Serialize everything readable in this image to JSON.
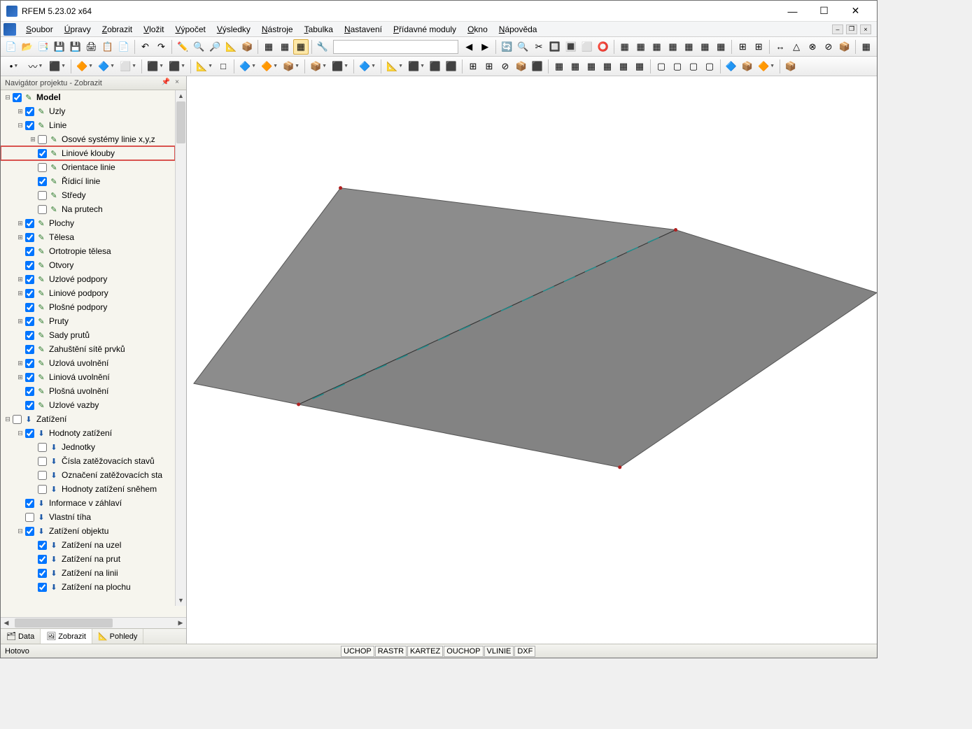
{
  "title": "RFEM 5.23.02 x64",
  "menu": [
    "Soubor",
    "Úpravy",
    "Zobrazit",
    "Vložit",
    "Výpočet",
    "Výsledky",
    "Nástroje",
    "Tabulka",
    "Nastavení",
    "Přídavné moduly",
    "Okno",
    "Nápověda"
  ],
  "nav_header": "Navigátor projektu - Zobrazit",
  "tree": [
    {
      "lvl": 0,
      "tw": "-",
      "chk": true,
      "ic": "p",
      "txt": "Model",
      "bold": true
    },
    {
      "lvl": 1,
      "tw": "+",
      "chk": true,
      "ic": "p",
      "txt": "Uzly"
    },
    {
      "lvl": 1,
      "tw": "-",
      "chk": true,
      "ic": "p",
      "txt": "Linie"
    },
    {
      "lvl": 2,
      "tw": "+",
      "chk": false,
      "ic": "p",
      "txt": "Osové systémy linie x,y,z"
    },
    {
      "lvl": 2,
      "tw": "",
      "chk": true,
      "ic": "p",
      "txt": "Liniové klouby",
      "hl": true
    },
    {
      "lvl": 2,
      "tw": "",
      "chk": false,
      "ic": "p",
      "txt": "Orientace linie"
    },
    {
      "lvl": 2,
      "tw": "",
      "chk": true,
      "ic": "p",
      "txt": "Řídicí linie"
    },
    {
      "lvl": 2,
      "tw": "",
      "chk": false,
      "ic": "p",
      "txt": "Středy"
    },
    {
      "lvl": 2,
      "tw": "",
      "chk": false,
      "ic": "p",
      "txt": "Na prutech"
    },
    {
      "lvl": 1,
      "tw": "+",
      "chk": true,
      "ic": "p",
      "txt": "Plochy"
    },
    {
      "lvl": 1,
      "tw": "+",
      "chk": true,
      "ic": "p",
      "txt": "Tělesa"
    },
    {
      "lvl": 1,
      "tw": "",
      "chk": true,
      "ic": "p",
      "txt": "Ortotropie tělesa"
    },
    {
      "lvl": 1,
      "tw": "",
      "chk": true,
      "ic": "p",
      "txt": "Otvory"
    },
    {
      "lvl": 1,
      "tw": "+",
      "chk": true,
      "ic": "p",
      "txt": "Uzlové podpory"
    },
    {
      "lvl": 1,
      "tw": "+",
      "chk": true,
      "ic": "p",
      "txt": "Liniové podpory"
    },
    {
      "lvl": 1,
      "tw": "",
      "chk": true,
      "ic": "p",
      "txt": "Plošné podpory"
    },
    {
      "lvl": 1,
      "tw": "+",
      "chk": true,
      "ic": "p",
      "txt": "Pruty"
    },
    {
      "lvl": 1,
      "tw": "",
      "chk": true,
      "ic": "p",
      "txt": "Sady prutů"
    },
    {
      "lvl": 1,
      "tw": "",
      "chk": true,
      "ic": "p",
      "txt": "Zahuštění sítě prvků"
    },
    {
      "lvl": 1,
      "tw": "+",
      "chk": true,
      "ic": "p",
      "txt": "Uzlová uvolnění"
    },
    {
      "lvl": 1,
      "tw": "+",
      "chk": true,
      "ic": "p",
      "txt": "Liniová uvolnění"
    },
    {
      "lvl": 1,
      "tw": "",
      "chk": true,
      "ic": "p",
      "txt": "Plošná uvolnění"
    },
    {
      "lvl": 1,
      "tw": "",
      "chk": true,
      "ic": "p",
      "txt": "Uzlové vazby"
    },
    {
      "lvl": 0,
      "tw": "-",
      "chk": false,
      "ic": "a",
      "txt": "Zatížení"
    },
    {
      "lvl": 1,
      "tw": "-",
      "chk": true,
      "ic": "a",
      "txt": "Hodnoty zatížení"
    },
    {
      "lvl": 2,
      "tw": "",
      "chk": false,
      "ic": "a",
      "txt": "Jednotky"
    },
    {
      "lvl": 2,
      "tw": "",
      "chk": false,
      "ic": "a",
      "txt": "Čísla zatěžovacích stavů"
    },
    {
      "lvl": 2,
      "tw": "",
      "chk": false,
      "ic": "a",
      "txt": "Označení zatěžovacích sta"
    },
    {
      "lvl": 2,
      "tw": "",
      "chk": false,
      "ic": "a",
      "txt": "Hodnoty zatížení sněhem "
    },
    {
      "lvl": 1,
      "tw": "",
      "chk": true,
      "ic": "a",
      "txt": "Informace v záhlaví"
    },
    {
      "lvl": 1,
      "tw": "",
      "chk": false,
      "ic": "a",
      "txt": "Vlastní tíha"
    },
    {
      "lvl": 1,
      "tw": "-",
      "chk": true,
      "ic": "a",
      "txt": "Zatížení objektu"
    },
    {
      "lvl": 2,
      "tw": "",
      "chk": true,
      "ic": "a",
      "txt": "Zatížení na uzel"
    },
    {
      "lvl": 2,
      "tw": "",
      "chk": true,
      "ic": "a",
      "txt": "Zatížení na prut"
    },
    {
      "lvl": 2,
      "tw": "",
      "chk": true,
      "ic": "a",
      "txt": "Zatížení na linii"
    },
    {
      "lvl": 2,
      "tw": "",
      "chk": true,
      "ic": "a",
      "txt": "Zatížení na plochu"
    }
  ],
  "nav_tabs": [
    {
      "icon": "🗂",
      "label": "Data"
    },
    {
      "icon": "🖼",
      "label": "Zobrazit",
      "active": true
    },
    {
      "icon": "📐",
      "label": "Pohledy"
    }
  ],
  "status_text": "Hotovo",
  "status_btns": [
    "UCHOP",
    "RASTR",
    "KARTEZ",
    "OUCHOP",
    "VLINIE",
    "DXF"
  ],
  "toolbar1_icons": [
    "📄",
    "📂",
    "📑",
    "💾",
    "💾",
    "🖨",
    "📋",
    "📄",
    "|",
    "↶",
    "↷",
    "|",
    "✏️",
    "🔍",
    "🔎",
    "📐",
    "📦",
    "|",
    "▦",
    "▦",
    "▦",
    "|",
    "🔧"
  ],
  "toolbar1_nav": [
    "◀",
    "▶",
    "|",
    "🔄",
    "🔍",
    "✂",
    "🔲",
    "🔳",
    "⬜",
    "⭕",
    "|",
    "▦",
    "▦",
    "▦",
    "▦",
    "▦",
    "▦",
    "▦",
    "|",
    "⊞",
    "⊞",
    "|",
    "↔",
    "△",
    "⊗",
    "⊘",
    "📦",
    "|",
    "▦"
  ],
  "toolbar2_icons": [
    "•",
    "▾",
    "〰",
    "▾",
    "⬛",
    "▾",
    "|",
    "🔶",
    "▾",
    "🔷",
    "▾",
    "⬜",
    "▾",
    "|",
    "⬛",
    "▾",
    "⬛",
    "▾",
    "|",
    "📐",
    "▾",
    "□",
    "|",
    "🔷",
    "▾",
    "🔶",
    "▾",
    "📦",
    "▾",
    "|",
    "📦",
    "▾",
    "⬛",
    "▾",
    "|",
    "🔷",
    "▾",
    "|",
    "📐",
    "▾",
    "⬛",
    "▾",
    "⬛",
    "⬛",
    "|",
    "⊞",
    "⊞",
    "⊘",
    "📦",
    "⬛",
    "|",
    "▦",
    "▦",
    "▦",
    "▦",
    "▦",
    "▦",
    "|",
    "▢",
    "▢",
    "▢",
    "▢",
    "|",
    "🔷",
    "📦",
    "🔶",
    "▾",
    "|",
    "📦"
  ]
}
